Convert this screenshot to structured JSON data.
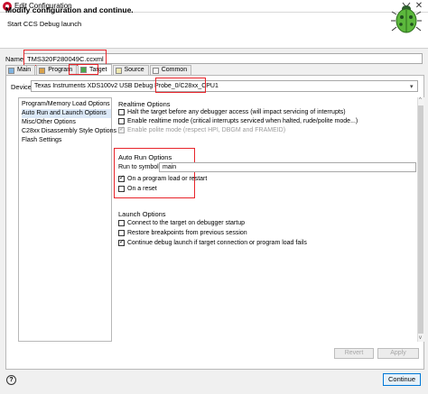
{
  "window": {
    "title": "Edit Configuration",
    "close_glyph": "✕"
  },
  "header": {
    "title": "Modify configuration and continue.",
    "subtitle": "Start CCS Debug launch",
    "icon": "ladybug-debug-icon"
  },
  "name_field": {
    "label": "Name",
    "value": "TMS320F280049C.ccxml"
  },
  "tabs": [
    {
      "label": "Main",
      "icon": "main-icon"
    },
    {
      "label": "Program",
      "icon": "program-icon"
    },
    {
      "label": "Target",
      "icon": "target-icon",
      "active": true
    },
    {
      "label": "Source",
      "icon": "source-icon"
    },
    {
      "label": "Common",
      "icon": "common-icon"
    }
  ],
  "device": {
    "label": "Device",
    "value": "Texas Instruments XDS100v2 USB Debug Probe_0/C28xx_CPU1"
  },
  "nav_items": [
    {
      "label": "Program/Memory Load Options"
    },
    {
      "label": "Auto Run and Launch Options",
      "selected": true
    },
    {
      "label": "Misc/Other Options"
    },
    {
      "label": "C28xx Disassembly Style Options"
    },
    {
      "label": "Flash Settings"
    }
  ],
  "realtime": {
    "title": "Realtime Options",
    "options": [
      {
        "label": "Halt the target before any debugger access (will impact servicing of interrupts)",
        "checked": false
      },
      {
        "label": "Enable realtime mode (critical interrupts serviced when halted, rude/polite mode...)",
        "checked": false
      },
      {
        "label": "Enable polite mode (respect HPI, DBGM and FRAMEID)",
        "checked": true,
        "disabled": true
      }
    ]
  },
  "auto_run": {
    "title": "Auto Run Options",
    "run_to_symbol_label": "Run to symbol",
    "run_to_symbol_value": "main",
    "options": [
      {
        "label": "On a program load or restart",
        "checked": true
      },
      {
        "label": "On a reset",
        "checked": false
      }
    ]
  },
  "launch": {
    "title": "Launch Options",
    "options": [
      {
        "label": "Connect to the target on debugger startup",
        "checked": false
      },
      {
        "label": "Restore breakpoints from previous session",
        "checked": false
      },
      {
        "label": "Continue debug launch if target connection or program load fails",
        "checked": true
      }
    ]
  },
  "buttons": {
    "revert": "Revert",
    "apply": "Apply",
    "continue": "Continue",
    "help": "?"
  },
  "colors": {
    "highlight_box": "#e8242a",
    "selection": "#dce9f8",
    "default_button_border": "#0078d7"
  }
}
